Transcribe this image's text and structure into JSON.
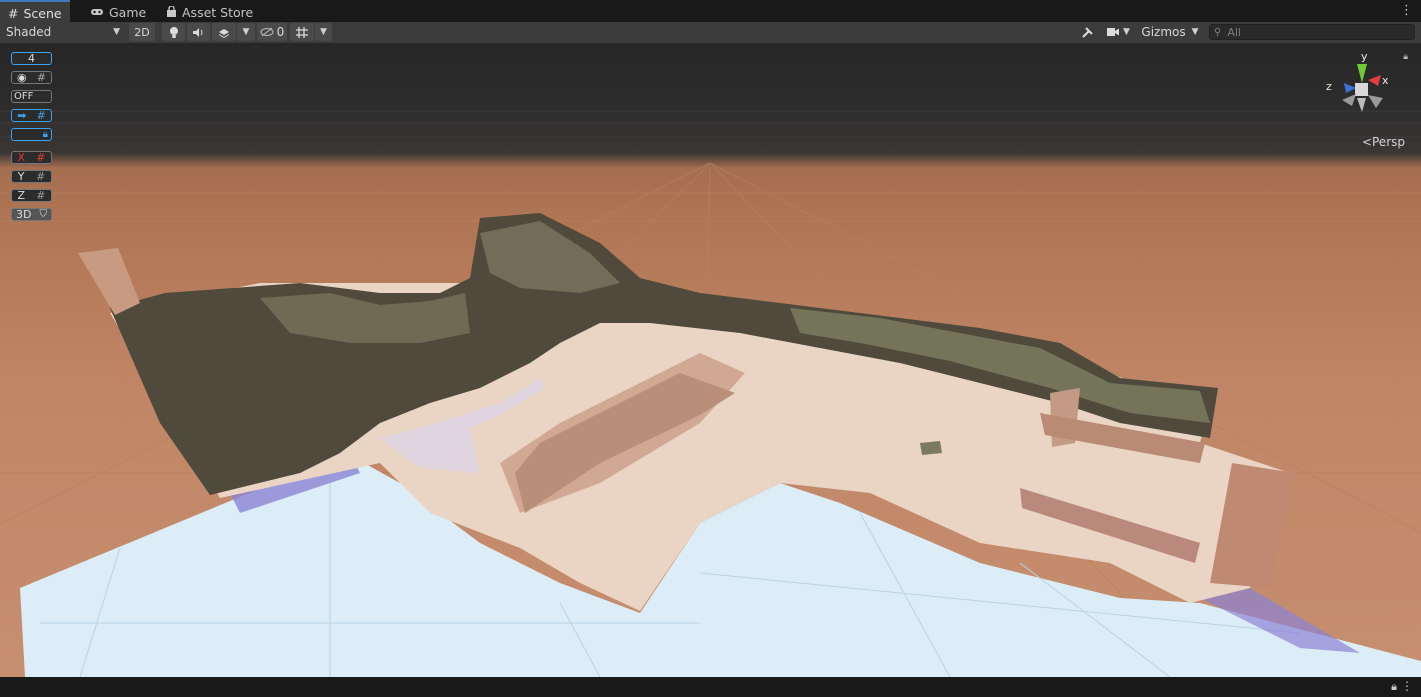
{
  "tabs": [
    {
      "label": "Scene",
      "icon": "hash-grid-icon",
      "active": true
    },
    {
      "label": "Game",
      "icon": "gamepad-icon",
      "active": false
    },
    {
      "label": "Asset Store",
      "icon": "shopping-bag-icon",
      "active": false
    }
  ],
  "toolbar": {
    "shading_mode": "Shaded",
    "mode_2d": "2D",
    "hidden_count": "0",
    "gizmos_label": "Gizmos",
    "search_placeholder": "All"
  },
  "overlay": {
    "grid_size": "4",
    "snap_off": "OFF",
    "axis_x": "X",
    "axis_y": "Y",
    "axis_z": "Z",
    "mode_3d": "3D"
  },
  "gizmo": {
    "y_label": "y",
    "x_label": "x",
    "z_label": "z",
    "projection": "Persp"
  },
  "colors": {
    "accent_blue": "#3ba3f0",
    "axis_red": "#e23c3c",
    "axis_green": "#6ccb34",
    "ground": "#c08666",
    "water": "#d8ecf8",
    "sand": "#e9d2c2",
    "rock": "#5a5444"
  }
}
